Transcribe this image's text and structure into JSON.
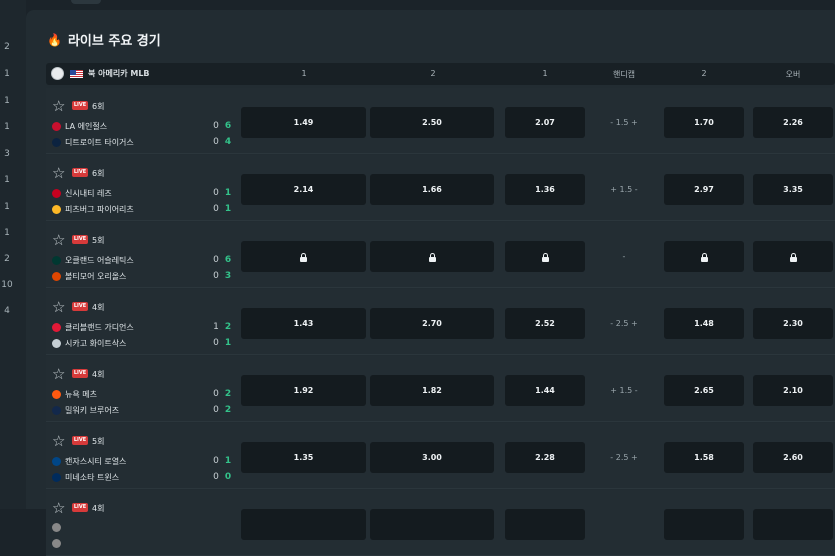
{
  "left_rail": {
    "numbers": [
      "2",
      "1",
      "1",
      "1",
      "3",
      "1",
      "1",
      "1",
      "2",
      "10",
      "4"
    ]
  },
  "section": {
    "title": "라이브 주요 경기",
    "fire_icon": "fire-icon"
  },
  "league": {
    "name": "북 아메리카 MLB",
    "columns": [
      "1",
      "2",
      "1",
      "핸디캡",
      "2",
      "오버"
    ]
  },
  "matches": [
    {
      "inning": "6회",
      "live": "LIVE",
      "home": {
        "name": "LA 에인절스",
        "color": "#c8102e",
        "s1": "0",
        "s2": "6"
      },
      "away": {
        "name": "디트로이트 타이거스",
        "color": "#0c2340",
        "s1": "0",
        "s2": "4"
      },
      "odds": [
        "1.49",
        "2.50",
        "2.07",
        "- 1.5 +",
        "1.70",
        "2.26"
      ]
    },
    {
      "inning": "6회",
      "live": "LIVE",
      "home": {
        "name": "신시내티 레즈",
        "color": "#c6011f",
        "s1": "0",
        "s2": "1"
      },
      "away": {
        "name": "피츠버그 파이어리츠",
        "color": "#fdb827",
        "s1": "0",
        "s2": "1"
      },
      "odds": [
        "2.14",
        "1.66",
        "1.36",
        "+ 1.5 -",
        "2.97",
        "3.35"
      ]
    },
    {
      "inning": "5회",
      "live": "LIVE",
      "locked": true,
      "home": {
        "name": "오클랜드 어슬레틱스",
        "color": "#003831",
        "s1": "0",
        "s2": "6"
      },
      "away": {
        "name": "볼티모어 오리올스",
        "color": "#df4601",
        "s1": "0",
        "s2": "3"
      },
      "odds": [
        "",
        "",
        "",
        "-",
        "",
        ""
      ]
    },
    {
      "inning": "4회",
      "live": "LIVE",
      "home": {
        "name": "클리블랜드 가디언스",
        "color": "#e31937",
        "s1": "1",
        "s2": "2"
      },
      "away": {
        "name": "시카고 화이트삭스",
        "color": "#c4ced4",
        "s1": "0",
        "s2": "1"
      },
      "odds": [
        "1.43",
        "2.70",
        "2.52",
        "- 2.5 +",
        "1.48",
        "2.30"
      ]
    },
    {
      "inning": "4회",
      "live": "LIVE",
      "home": {
        "name": "뉴욕 메츠",
        "color": "#ff5910",
        "s1": "0",
        "s2": "2"
      },
      "away": {
        "name": "밀워키 브루어즈",
        "color": "#12284b",
        "s1": "0",
        "s2": "2"
      },
      "odds": [
        "1.92",
        "1.82",
        "1.44",
        "+ 1.5 -",
        "2.65",
        "2.10"
      ]
    },
    {
      "inning": "5회",
      "live": "LIVE",
      "home": {
        "name": "캔자스시티 로열스",
        "color": "#004687",
        "s1": "0",
        "s2": "1"
      },
      "away": {
        "name": "미네소타 트윈스",
        "color": "#002b5c",
        "s1": "0",
        "s2": "0"
      },
      "odds": [
        "1.35",
        "3.00",
        "2.28",
        "- 2.5 +",
        "1.58",
        "2.60"
      ]
    },
    {
      "inning": "4회",
      "live": "LIVE",
      "home": {
        "name": "",
        "color": "#888888",
        "s1": "",
        "s2": ""
      },
      "away": {
        "name": "",
        "color": "#888888",
        "s1": "",
        "s2": ""
      },
      "odds": [
        "",
        "",
        "",
        "",
        "",
        ""
      ]
    }
  ]
}
